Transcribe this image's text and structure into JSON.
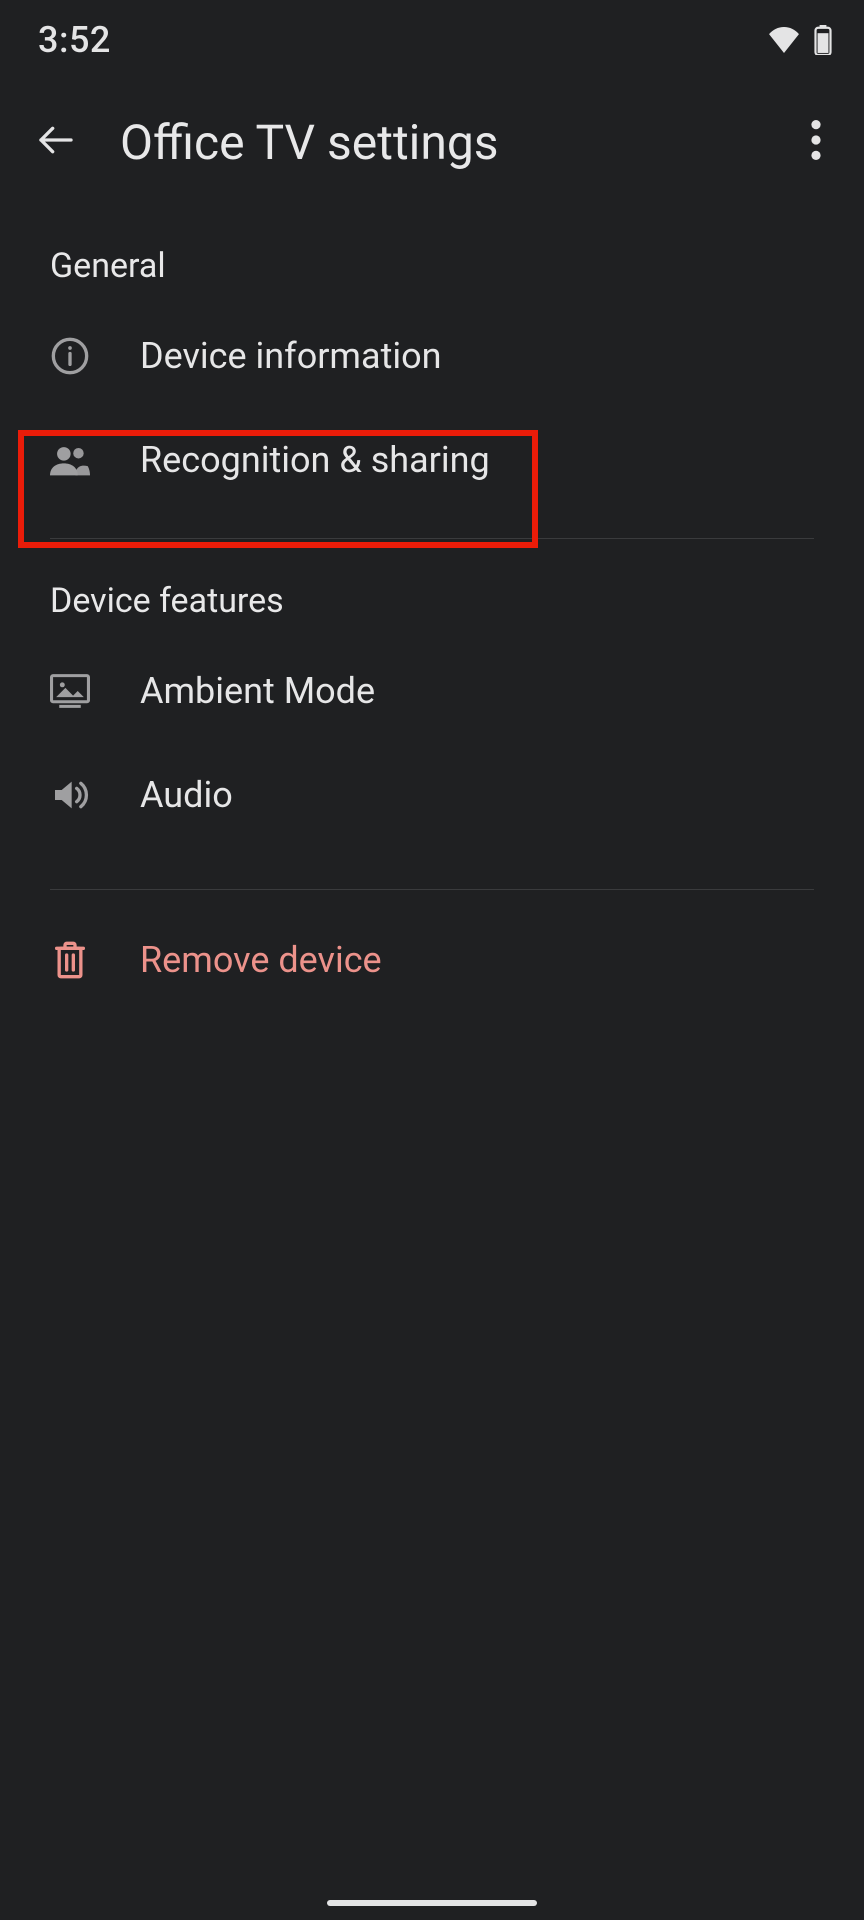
{
  "statusbar": {
    "time": "3:52"
  },
  "appbar": {
    "title": "Office TV settings"
  },
  "sections": {
    "general": {
      "header": "General",
      "items": [
        {
          "label": "Device information"
        },
        {
          "label": "Recognition & sharing"
        }
      ]
    },
    "device_features": {
      "header": "Device features",
      "items": [
        {
          "label": "Ambient Mode"
        },
        {
          "label": "Audio"
        }
      ]
    },
    "remove": {
      "label": "Remove device"
    }
  },
  "colors": {
    "background": "#1f2022",
    "text": "#e4e4e5",
    "muted_icon": "#9f9fa1",
    "danger": "#ec928b",
    "highlight": "#ea1c09"
  },
  "highlight": {
    "target": "recognition-sharing"
  }
}
